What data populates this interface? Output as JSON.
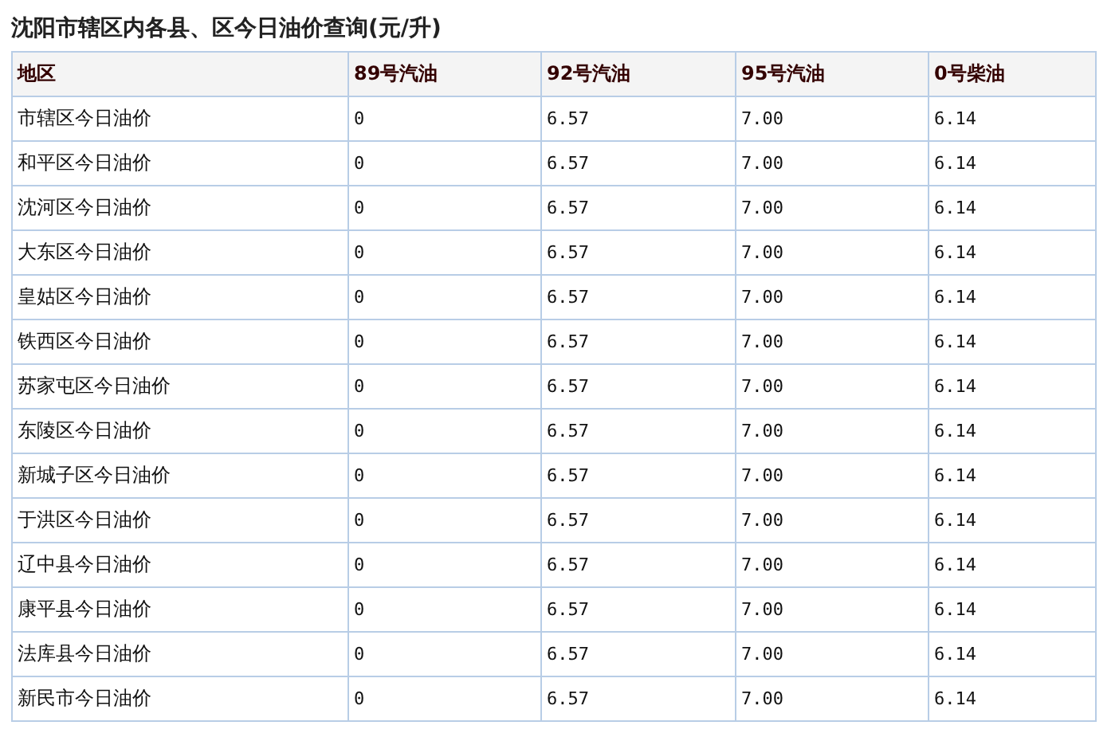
{
  "title": "沈阳市辖区内各县、区今日油价查询(元/升)",
  "table": {
    "columns": [
      "地区",
      "89号汽油",
      "92号汽油",
      "95号汽油",
      "0号柴油"
    ],
    "rows": [
      [
        "市辖区今日油价",
        "0",
        "6.57",
        "7.00",
        "6.14"
      ],
      [
        "和平区今日油价",
        "0",
        "6.57",
        "7.00",
        "6.14"
      ],
      [
        "沈河区今日油价",
        "0",
        "6.57",
        "7.00",
        "6.14"
      ],
      [
        "大东区今日油价",
        "0",
        "6.57",
        "7.00",
        "6.14"
      ],
      [
        "皇姑区今日油价",
        "0",
        "6.57",
        "7.00",
        "6.14"
      ],
      [
        "铁西区今日油价",
        "0",
        "6.57",
        "7.00",
        "6.14"
      ],
      [
        "苏家屯区今日油价",
        "0",
        "6.57",
        "7.00",
        "6.14"
      ],
      [
        "东陵区今日油价",
        "0",
        "6.57",
        "7.00",
        "6.14"
      ],
      [
        "新城子区今日油价",
        "0",
        "6.57",
        "7.00",
        "6.14"
      ],
      [
        "于洪区今日油价",
        "0",
        "6.57",
        "7.00",
        "6.14"
      ],
      [
        "辽中县今日油价",
        "0",
        "6.57",
        "7.00",
        "6.14"
      ],
      [
        "康平县今日油价",
        "0",
        "6.57",
        "7.00",
        "6.14"
      ],
      [
        "法库县今日油价",
        "0",
        "6.57",
        "7.00",
        "6.14"
      ],
      [
        "新民市今日油价",
        "0",
        "6.57",
        "7.00",
        "6.14"
      ]
    ]
  }
}
